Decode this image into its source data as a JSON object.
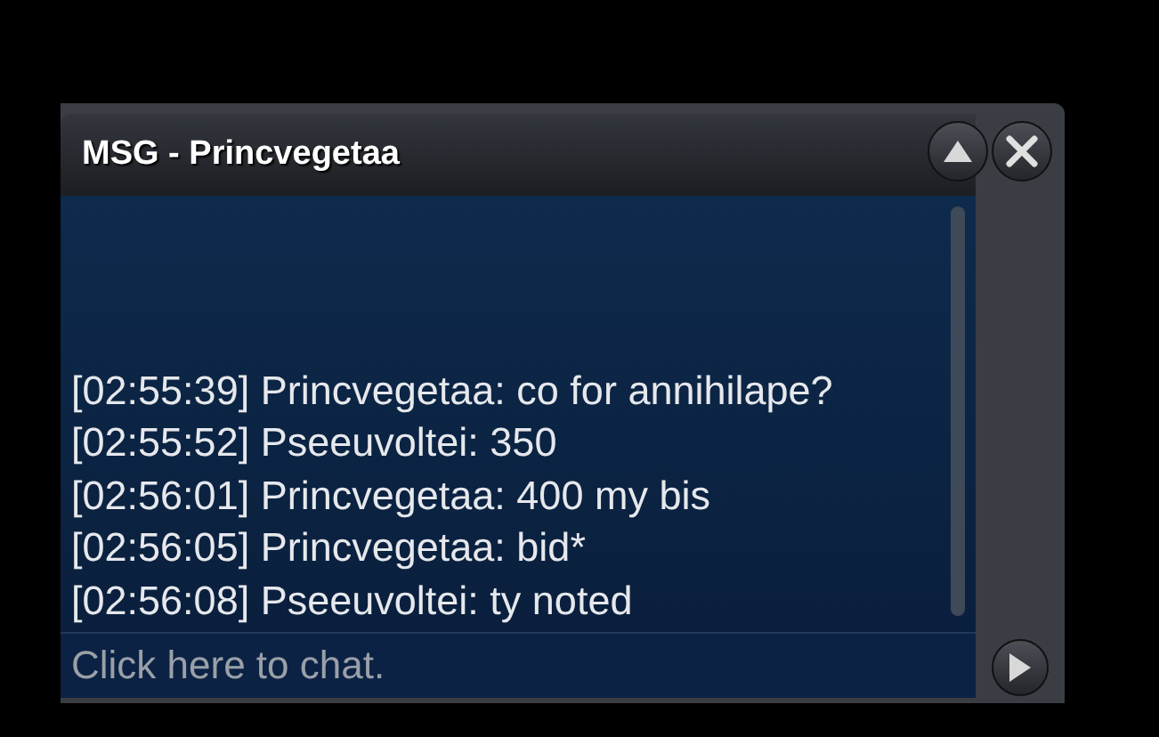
{
  "window": {
    "title": "MSG - Princvegetaa"
  },
  "messages": [
    {
      "time": "[02:55:39]",
      "sender": "Princvegetaa:",
      "text": "co for annihilape?"
    },
    {
      "time": "[02:55:52]",
      "sender": "Pseeuvoltei:",
      "text": "350"
    },
    {
      "time": "[02:56:01]",
      "sender": "Princvegetaa:",
      "text": "400 my bis"
    },
    {
      "time": "[02:56:05]",
      "sender": "Princvegetaa:",
      "text": "bid*"
    },
    {
      "time": "[02:56:08]",
      "sender": "Pseeuvoltei:",
      "text": "ty noted"
    }
  ],
  "chat_input": {
    "placeholder": "Click here to chat."
  }
}
